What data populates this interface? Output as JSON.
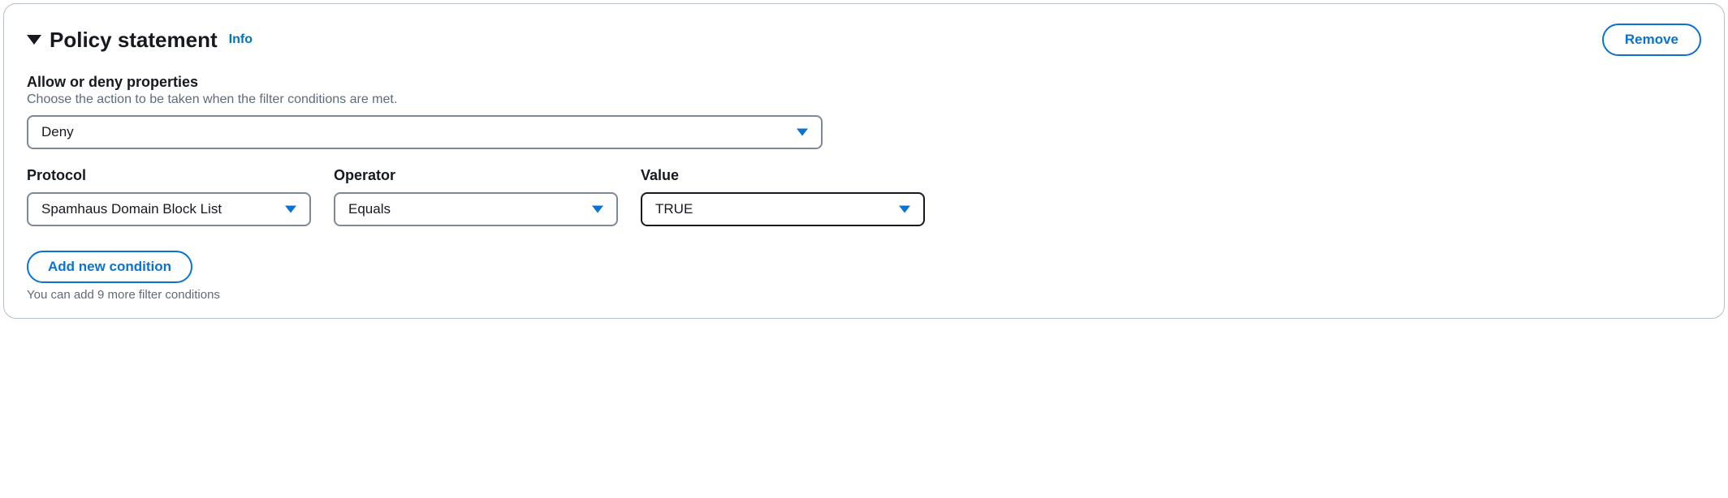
{
  "header": {
    "title": "Policy statement",
    "info_link": "Info",
    "remove_button": "Remove"
  },
  "allow_deny": {
    "label": "Allow or deny properties",
    "description": "Choose the action to be taken when the filter conditions are met.",
    "selected": "Deny"
  },
  "condition_row": {
    "protocol": {
      "label": "Protocol",
      "selected": "Spamhaus Domain Block List"
    },
    "operator": {
      "label": "Operator",
      "selected": "Equals"
    },
    "value": {
      "label": "Value",
      "selected": "TRUE"
    }
  },
  "add_condition": {
    "button": "Add new condition",
    "helper": "You can add 9 more filter conditions"
  }
}
